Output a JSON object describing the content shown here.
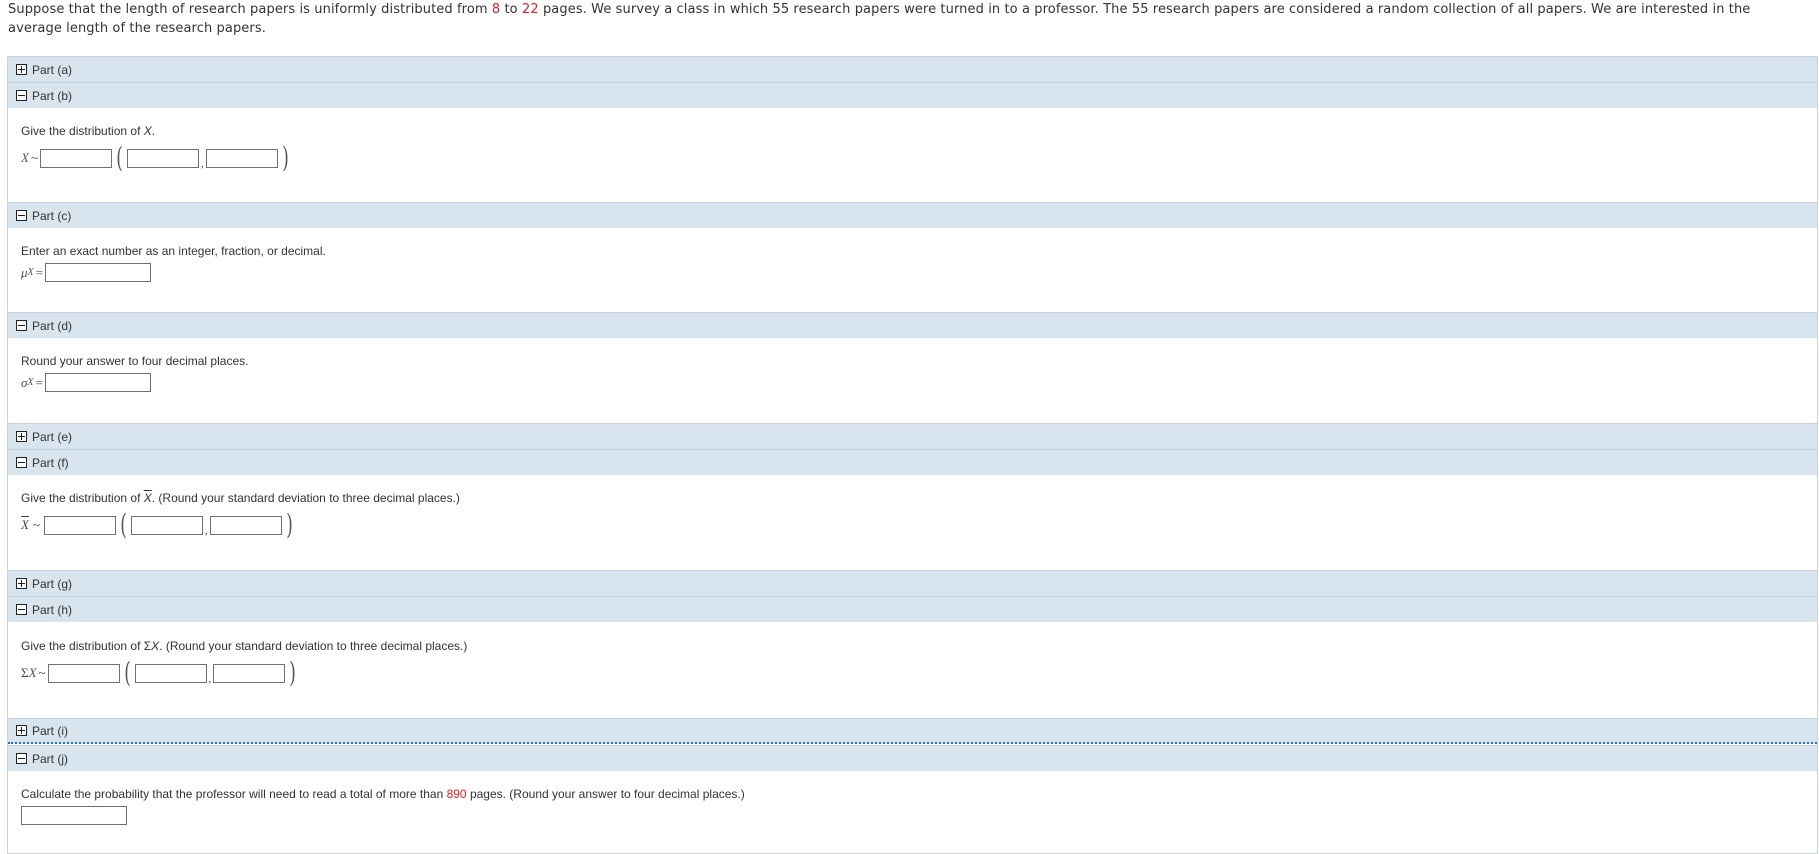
{
  "problem": {
    "p1": "Suppose that the length of research papers is uniformly distributed from ",
    "low": "8",
    "p2": " to ",
    "high": "22",
    "p3": " pages. We survey a class in which 55 research papers were turned in to a professor. The 55 research papers are considered a random collection of all papers. We are interested in the average length of the research papers."
  },
  "parts": {
    "a": "Part (a)",
    "b": "Part (b)",
    "c": "Part (c)",
    "d": "Part (d)",
    "e": "Part (e)",
    "f": "Part (f)",
    "g": "Part (g)",
    "h": "Part (h)",
    "i": "Part (i)",
    "j": "Part (j)"
  },
  "b": {
    "prompt_1": "Give the distribution of ",
    "prompt_var": "X",
    "prompt_2": ".",
    "lhs_var": "X",
    "tilde": "~"
  },
  "c": {
    "prompt": "Enter an exact number as an integer, fraction, or decimal.",
    "mu": "μ",
    "sub": "X",
    "eq": "="
  },
  "d": {
    "prompt": "Round your answer to four decimal places.",
    "sigma": "σ",
    "sub": "X",
    "eq": "="
  },
  "f": {
    "prompt_1": "Give the distribution of ",
    "prompt_var": "X",
    "prompt_2": ".  (Round your standard deviation to three decimal places.)",
    "lhs_var": "X",
    "tilde": "~"
  },
  "h": {
    "prompt_1": "Give the distribution of Σ",
    "prompt_var": "X",
    "prompt_2": ". (Round your standard deviation to three decimal places.)",
    "lhs_sigma": "Σ",
    "lhs_var": "X",
    "tilde": "~"
  },
  "j": {
    "prompt_1": "Calculate the probability that the professor will need to read a total of more than ",
    "value": "890",
    "prompt_2": " pages. (Round your answer to four decimal places.)"
  },
  "comma": ",",
  "lparen": "(",
  "rparen": ")"
}
